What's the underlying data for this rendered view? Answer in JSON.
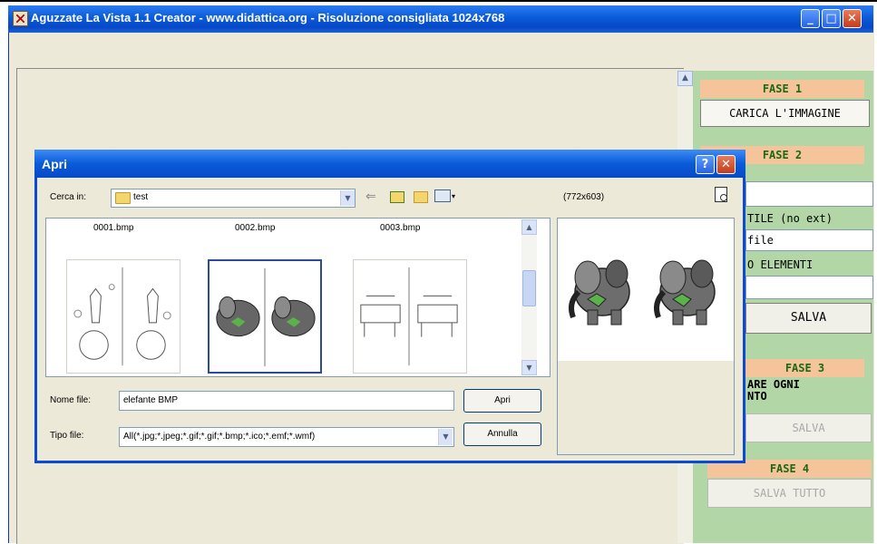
{
  "window": {
    "title": "Aguzzate La Vista 1.1 Creator - www.didattica.org - Risoluzione consigliata 1024x768",
    "minimize_glyph": "_",
    "maximize_glyph": "□",
    "close_glyph": "✕"
  },
  "right_panel": {
    "fase1": "FASE 1",
    "carica_button": "CARICA L'IMMAGINE",
    "fase2": "FASE 2",
    "file_label": "TILE (no ext)",
    "file_value": "file",
    "elementi_label": "O ELEMENTI",
    "salva_button": "SALVA",
    "fase3": "FASE 3",
    "fase3_text_line1": "ARE OGNI",
    "fase3_text_line2": "NTO",
    "salva_disabled": "SALVA",
    "fase4": "FASE 4",
    "salva_tutto": "SALVA TUTTO"
  },
  "dialog": {
    "title": "Apri",
    "help_glyph": "?",
    "close_glyph": "✕",
    "look_in_label": "Cerca in:",
    "look_in_value": "test",
    "preview_size": "(772x603)",
    "files": [
      {
        "name": "0001.bmp",
        "kind": "bubbles",
        "selected": false
      },
      {
        "name": "0002.bmp",
        "kind": "elephants",
        "selected": true
      },
      {
        "name": "0003.bmp",
        "kind": "cows",
        "selected": false
      }
    ],
    "filename_label": "Nome file:",
    "filename_value": "elefante BMP",
    "filetype_label": "Tipo file:",
    "filetype_value": "All(*.jpg;*.jpeg;*.gif;*.gif;*.bmp;*.ico;*.emf;*.wmf)",
    "open_button": "Apri",
    "cancel_button": "Annulla"
  }
}
